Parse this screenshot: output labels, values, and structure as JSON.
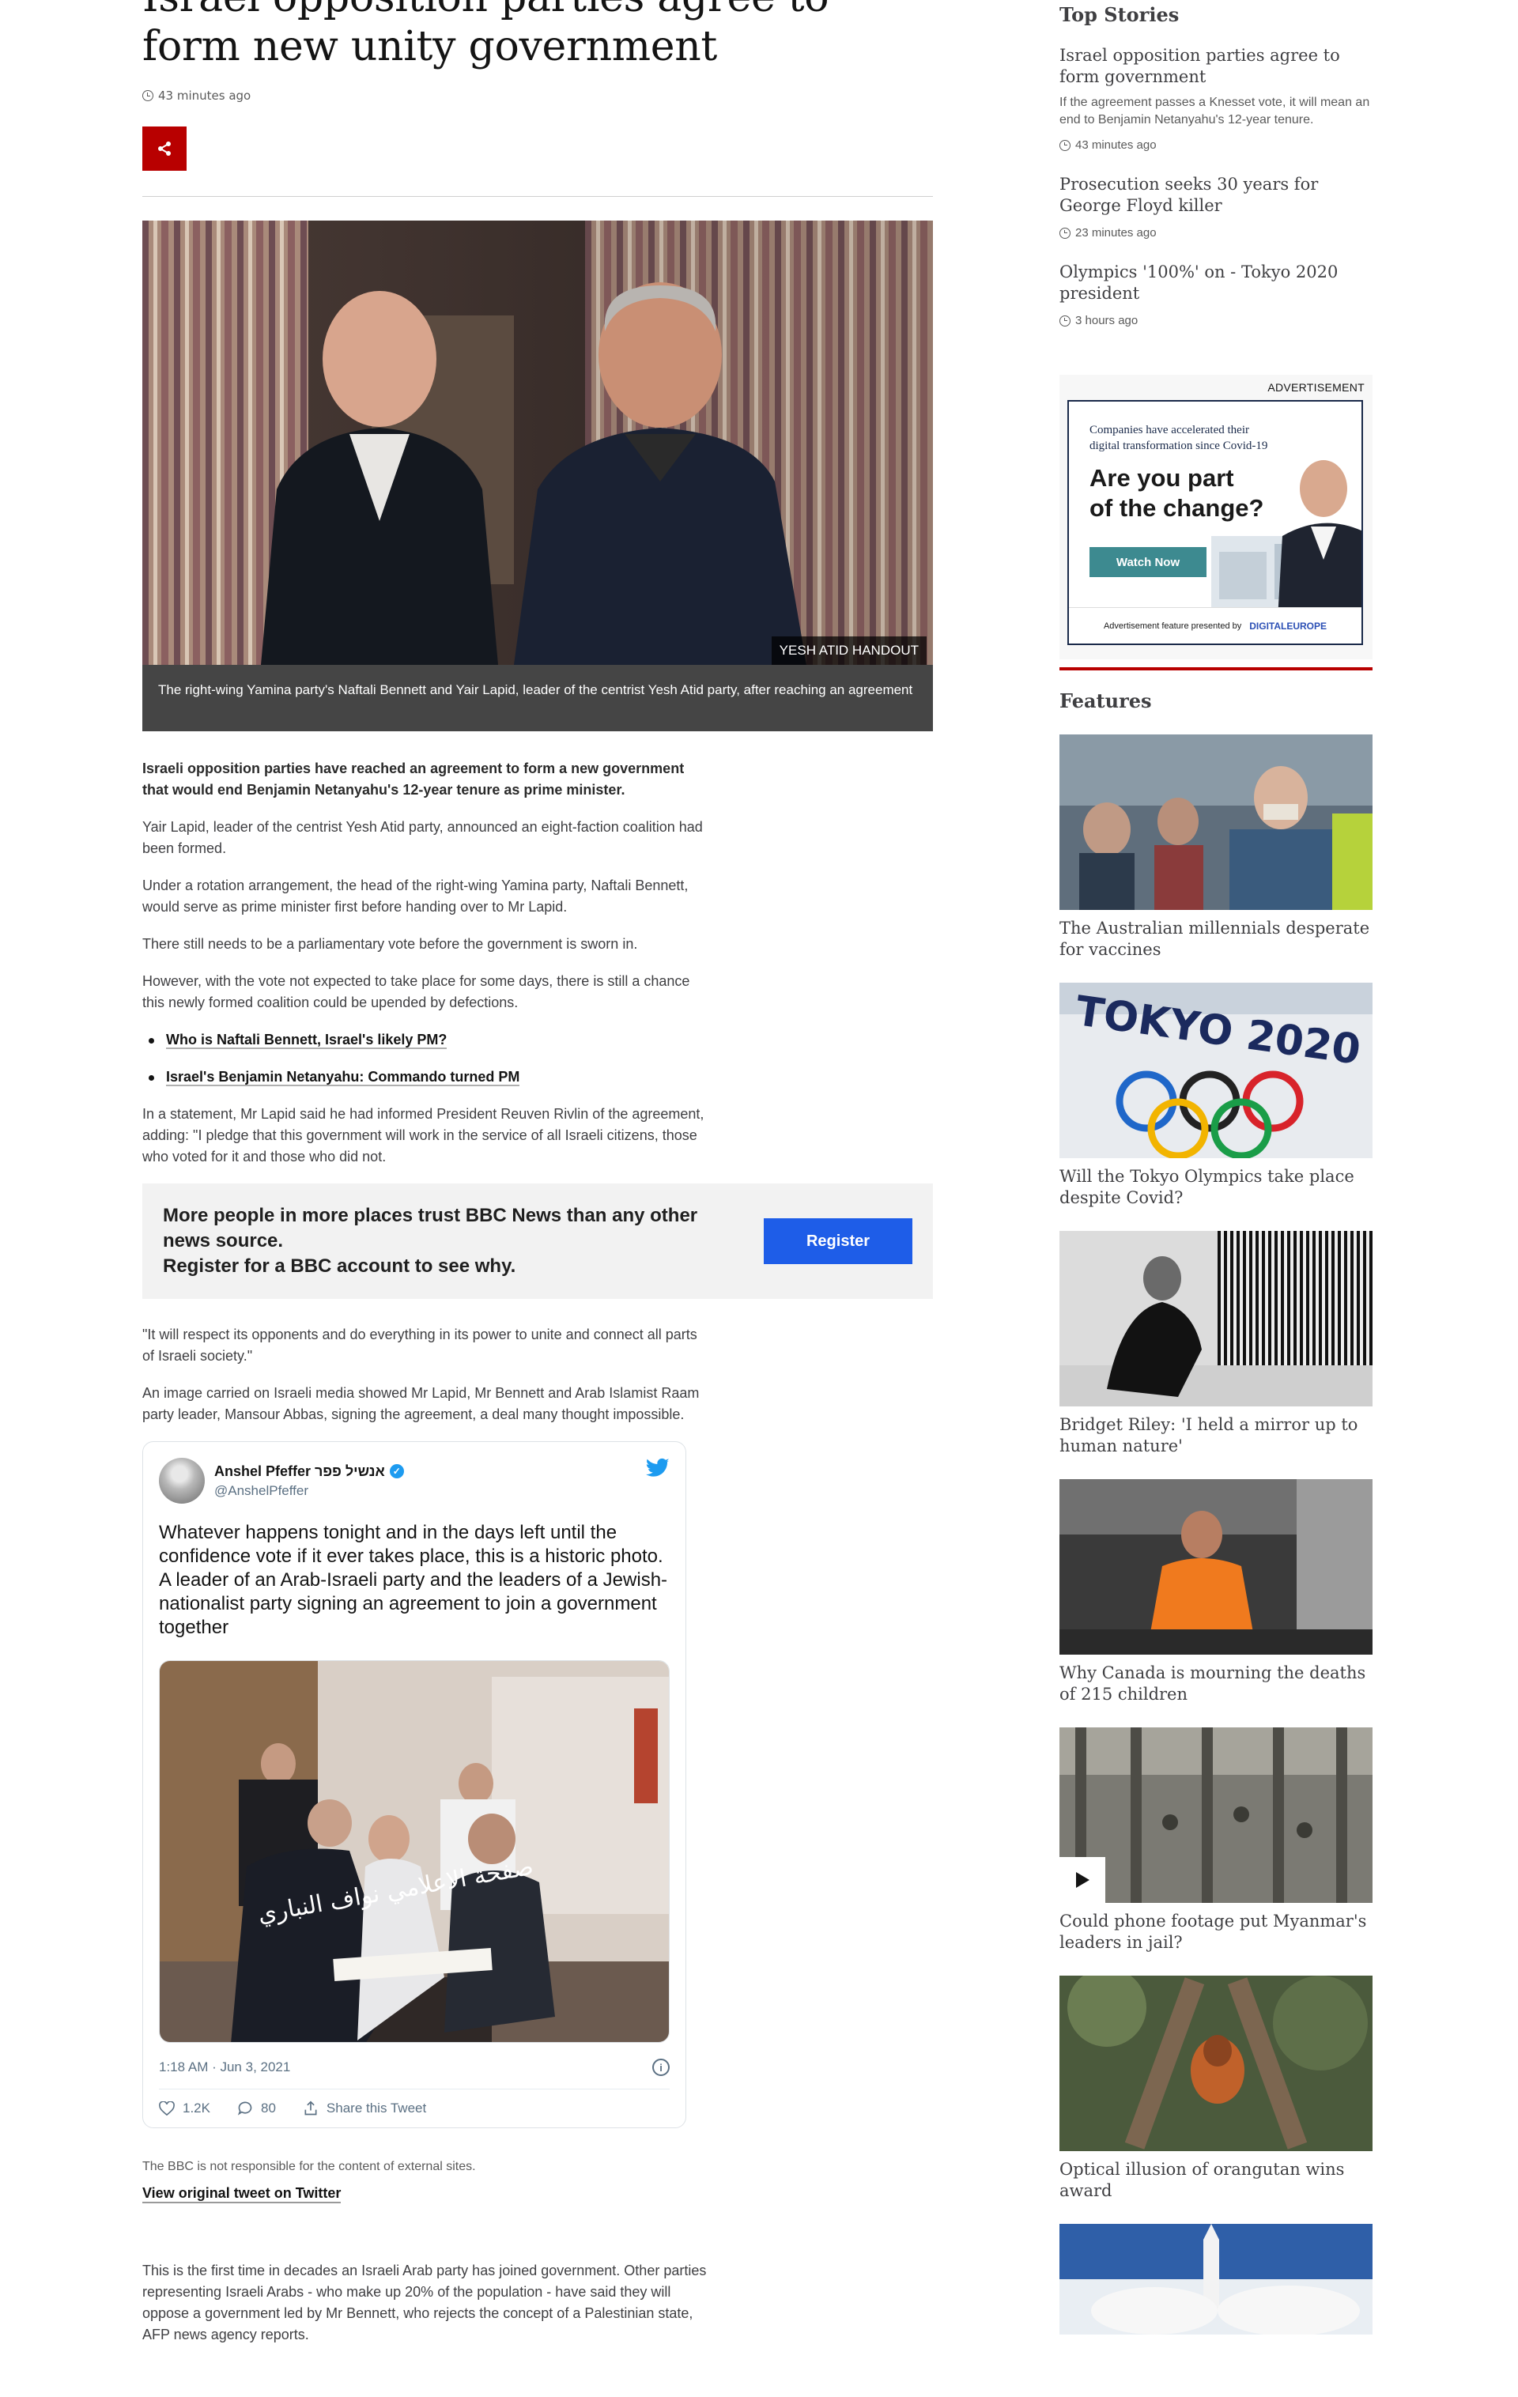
{
  "article": {
    "headline": "Israel opposition parties agree to form new unity government",
    "timestamp": "43 minutes ago",
    "image_credit": "YESH ATID HANDOUT",
    "image_caption": "The right-wing Yamina party's Naftali Bennett and Yair Lapid, leader of the centrist Yesh Atid party, after reaching an agreement",
    "intro": "Israeli opposition parties have reached an agreement to form a new government that would end Benjamin Netanyahu's 12-year tenure as prime minister.",
    "paragraphs": [
      "Yair Lapid, leader of the centrist Yesh Atid party, announced an eight-faction coalition had been formed.",
      "Under a rotation arrangement, the head of the right-wing Yamina party, Naftali Bennett, would serve as prime minister first before handing over to Mr Lapid.",
      "There still needs to be a parliamentary vote before the government is sworn in.",
      "However, with the vote not expected to take place for some days, there is still a chance this newly formed coalition could be upended by defections."
    ],
    "links": [
      "Who is Naftali Bennett, Israel's likely PM?",
      "Israel's Benjamin Netanyahu: Commando turned PM"
    ],
    "paragraph_after_links": "In a statement, Mr Lapid said he had informed President Reuven Rivlin of the agreement, adding: \"I pledge that this government will work in the service of all Israeli citizens, those who voted for it and those who did not.",
    "promo": {
      "text": "More people in more places trust BBC News than any other news source.\nRegister for a BBC account to see why.",
      "button": "Register"
    },
    "paragraphs_2": [
      "\"It will respect its opponents and do everything in its power to unite and connect all parts of Israeli society.\"",
      "An image carried on Israeli media showed Mr Lapid, Mr Bennett and Arab Islamist Raam party leader, Mansour Abbas, signing the agreement, a deal many thought impossible."
    ],
    "tweet": {
      "name": "Anshel Pfeffer אנשיל פפר",
      "handle": "@AnshelPfeffer",
      "text": "Whatever happens tonight and in the days left until the confidence vote if it ever takes place, this is a historic photo. A leader of an Arab-Israeli party and the leaders of a Jewish-nationalist party signing an agreement to join a government together",
      "photo_overlay": "صفحة الاعلامي نواف النباري",
      "date": "1:18 AM · Jun 3, 2021",
      "likes": "1.2K",
      "replies": "80",
      "share": "Share this Tweet"
    },
    "disclaimer": "The BBC is not responsible for the content of external sites.",
    "view_original": "View original tweet on Twitter",
    "closing": "This is the first time in decades an Israeli Arab party has joined government. Other parties representing Israeli Arabs - who make up 20% of the population - have said they will oppose a government led by Mr Bennett, who rejects the concept of a Palestinian state, AFP news agency reports."
  },
  "sidebar": {
    "top_stories_heading": "Top Stories",
    "top_stories": [
      {
        "title": "Israel opposition parties agree to form government",
        "summary": "If the agreement passes a Knesset vote, it will mean an end to Benjamin Netanyahu's 12-year tenure.",
        "time": "43 minutes ago"
      },
      {
        "title": "Prosecution seeks 30 years for George Floyd killer",
        "time": "23 minutes ago"
      },
      {
        "title": "Olympics '100%' on - Tokyo 2020 president",
        "time": "3 hours ago"
      }
    ],
    "ad": {
      "label": "ADVERTISEMENT",
      "small": "Companies have accelerated their digital transformation since Covid-19",
      "big": "Are you part of the change?",
      "button": "Watch Now",
      "foot": "Advertisement feature presented by",
      "brand": "DIGITALEUROPE"
    },
    "features_heading": "Features",
    "features": [
      {
        "title": "The Australian millennials desperate for vaccines"
      },
      {
        "title": "Will the Tokyo Olympics take place despite Covid?",
        "image_text": "TOKYO 2020"
      },
      {
        "title": "Bridget Riley: 'I held a mirror up to human nature'"
      },
      {
        "title": "Why Canada is mourning the deaths of 215 children"
      },
      {
        "title": "Could phone footage put Myanmar's leaders in jail?"
      },
      {
        "title": "Optical illusion of orangutan wins award"
      }
    ]
  },
  "colors": {
    "bbc_red": "#b80000",
    "register_blue": "#1e5de8",
    "twitter_blue": "#1d9bf0"
  },
  "icons": [
    "share-icon",
    "clock-icon",
    "twitter-bird-icon",
    "verified-badge-icon",
    "heart-icon",
    "reply-icon",
    "share-tweet-icon",
    "info-icon",
    "play-icon"
  ]
}
